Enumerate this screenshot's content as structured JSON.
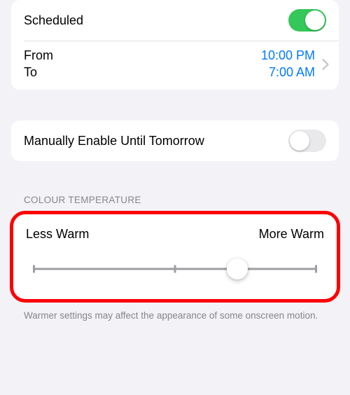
{
  "schedule_card": {
    "scheduled_label": "Scheduled",
    "scheduled_on": true,
    "from_label": "From",
    "to_label": "To",
    "from_value": "10:00 PM",
    "to_value": "7:00 AM"
  },
  "manual_card": {
    "label": "Manually Enable Until Tomorrow",
    "enabled": false
  },
  "temperature": {
    "header": "COLOUR TEMPERATURE",
    "less_label": "Less Warm",
    "more_label": "More Warm",
    "slider_percent": 72,
    "footer": "Warmer settings may affect the appearance of some onscreen motion."
  }
}
